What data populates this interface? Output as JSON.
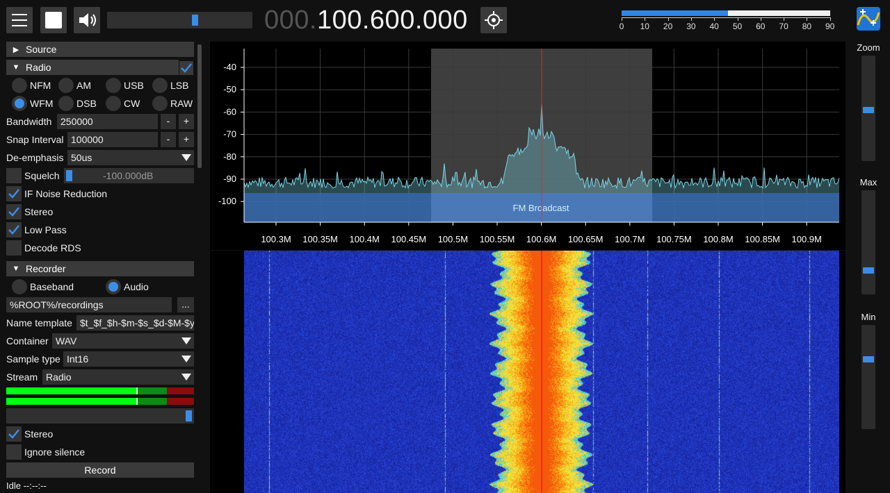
{
  "toolbar": {
    "menu_icon": "hamburger-icon",
    "stop_icon": "stop-icon",
    "volume_icon": "speaker-icon",
    "volume_level": 0.6,
    "frequency_dim": "000.",
    "frequency_bright": "100.600.000",
    "center_icon": "crosshair-icon",
    "snr_level_fraction": 0.51,
    "snr_ticks": [
      "0",
      "10",
      "20",
      "30",
      "40",
      "50",
      "60",
      "70",
      "80",
      "90"
    ],
    "logo_icon": "sdrpp-logo-icon"
  },
  "menu": {
    "source_label": "Source",
    "radio_label": "Radio",
    "demod_modes_row1": [
      "NFM",
      "AM",
      "USB",
      "LSB"
    ],
    "demod_modes_row2": [
      "WFM",
      "DSB",
      "CW",
      "RAW"
    ],
    "selected_mode": "WFM",
    "bandwidth_label": "Bandwidth",
    "bandwidth_value": "250000",
    "snap_label": "Snap Interval",
    "snap_value": "100000",
    "minus": "-",
    "plus": "+",
    "deemph_label": "De-emphasis",
    "deemph_value": "50us",
    "squelch_label": "Squelch",
    "squelch_value": "-100.000dB",
    "if_nr_label": "IF Noise Reduction",
    "stereo_label": "Stereo",
    "lowpass_label": "Low Pass",
    "rds_label": "Decode RDS",
    "recorder_label": "Recorder",
    "baseband_label": "Baseband",
    "audio_label": "Audio",
    "rec_path": "%ROOT%/recordings",
    "browse_label": "...",
    "name_template_label": "Name template",
    "name_template_value": "$t_$f_$h-$m-$s_$d-$M-$y",
    "container_label": "Container",
    "container_value": "WAV",
    "sample_type_label": "Sample type",
    "sample_type_value": "Int16",
    "stream_label": "Stream",
    "stream_value": "Radio",
    "rec_stereo_label": "Stereo",
    "ignore_silence_label": "Ignore silence",
    "record_button": "Record",
    "status_text": "Idle --:--:--"
  },
  "fft": {
    "y_ticks": [
      "-40",
      "-50",
      "-60",
      "-70",
      "-80",
      "-90",
      "-100"
    ],
    "x_ticks": [
      "100.3M",
      "100.35M",
      "100.4M",
      "100.45M",
      "100.5M",
      "100.55M",
      "100.6M",
      "100.65M",
      "100.7M",
      "100.75M",
      "100.8M",
      "100.85M",
      "100.9M"
    ],
    "band_label": "FM Broadcast",
    "band_color": "#0f2b8f",
    "trace_color": "#79d6e6",
    "center_line_color": "#ff2020"
  },
  "sliders": {
    "zoom_label": "Zoom",
    "max_label": "Max",
    "min_label": "Min"
  }
}
